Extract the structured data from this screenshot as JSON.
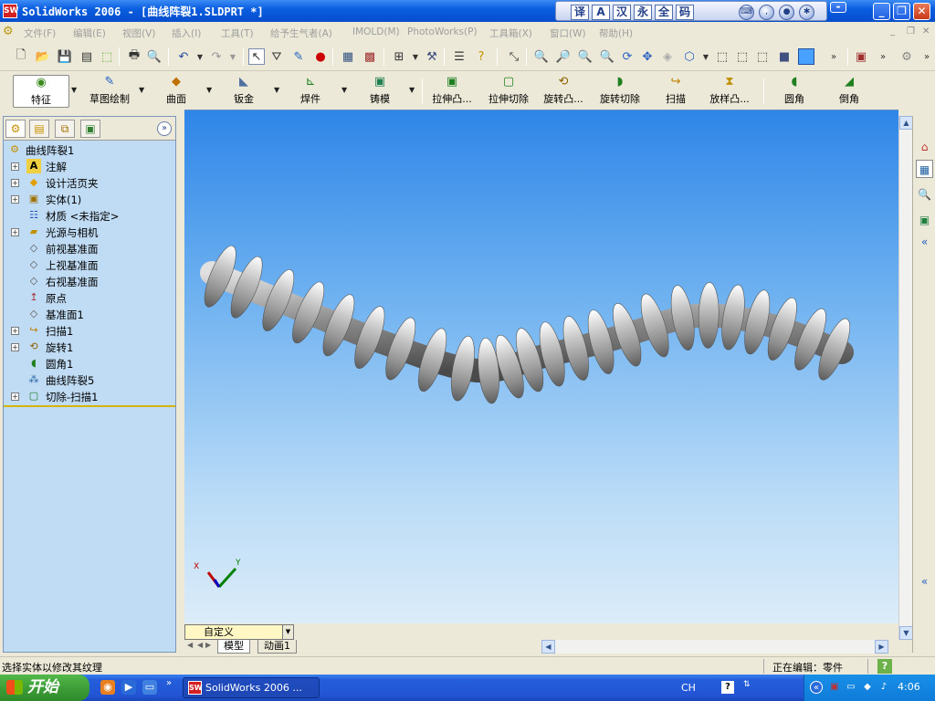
{
  "window": {
    "title": "SolidWorks 2006 - [曲线阵裂1.SLDPRT *]",
    "app_icon": "SW",
    "minimize_icon": "_",
    "restore_icon": "❐",
    "close_icon": "✕"
  },
  "ime_bar": {
    "buttons": [
      "译",
      "A",
      "汉",
      "永",
      "全",
      "码"
    ]
  },
  "menu": {
    "items": [
      "文件(F)",
      "编辑(E)",
      "视图(V)",
      "插入(I)",
      "工具(T)",
      "给予生气者(A)",
      "IMOLD(M)",
      "PhotoWorks(P)",
      "工具箱(X)",
      "窗口(W)",
      "帮助(H)"
    ]
  },
  "command_manager": {
    "groups": [
      "特征",
      "草图绘制",
      "曲面",
      "钣金",
      "焊件",
      "铸模"
    ],
    "features": [
      "拉伸凸...",
      "拉伸切除",
      "旋转凸...",
      "旋转切除",
      "扫描",
      "放样凸...",
      "圆角",
      "倒角"
    ]
  },
  "feature_tree": {
    "root": "曲线阵裂1",
    "items": [
      {
        "label": "注解",
        "expandable": true
      },
      {
        "label": "设计活页夹",
        "expandable": true
      },
      {
        "label": "实体(1)",
        "expandable": true
      },
      {
        "label": "材质 <未指定>",
        "expandable": false
      },
      {
        "label": "光源与相机",
        "expandable": true
      },
      {
        "label": "前视基准面",
        "expandable": false
      },
      {
        "label": "上视基准面",
        "expandable": false
      },
      {
        "label": "右视基准面",
        "expandable": false
      },
      {
        "label": "原点",
        "expandable": false
      },
      {
        "label": "基准面1",
        "expandable": false
      },
      {
        "label": "扫描1",
        "expandable": true
      },
      {
        "label": "旋转1",
        "expandable": true
      },
      {
        "label": "圆角1",
        "expandable": false
      },
      {
        "label": "曲线阵裂5",
        "expandable": false
      },
      {
        "label": "切除-扫描1",
        "expandable": true
      }
    ]
  },
  "triad": {
    "x": "X",
    "y": "Y"
  },
  "view": {
    "orientation": "自定义",
    "tabs": [
      "模型",
      "动画1"
    ]
  },
  "status": {
    "left": "选择实体以修改其纹理",
    "right": "正在编辑：零件",
    "help": "?"
  },
  "taskbar": {
    "start_label": "开始",
    "task_button": "SolidWorks 2006 ...",
    "language": "CH",
    "clock": "4:06"
  }
}
